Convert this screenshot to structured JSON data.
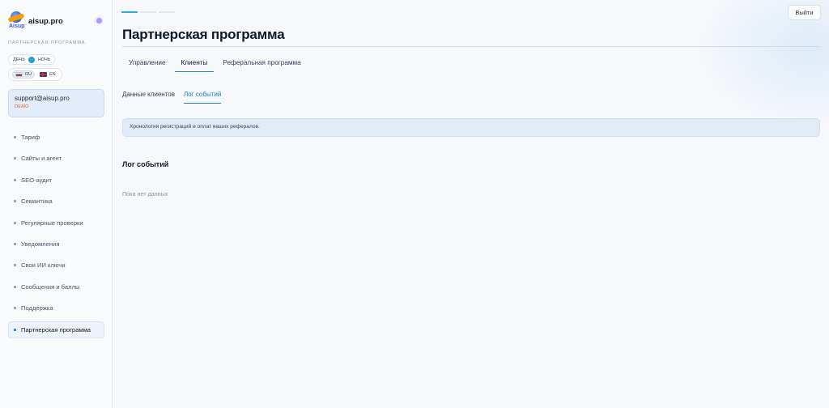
{
  "brand": {
    "name": "aisup.pro",
    "logo_tag": "Aisup"
  },
  "sidebar": {
    "caption": "ПАРТНЕРСКАЯ ПРОГРАММА",
    "theme": {
      "day": "ДЕНЬ",
      "night": "НОЧЬ"
    },
    "lang": {
      "ru": "RU",
      "en": "EN",
      "active": "RU"
    },
    "account": {
      "email": "support@aisup.pro",
      "plan": "DEMO"
    },
    "items": [
      {
        "label": "Тариф"
      },
      {
        "label": "Сайты и агент"
      },
      {
        "label": "SEO-аудит"
      },
      {
        "label": "Семантика"
      },
      {
        "label": "Регулярные проверки"
      },
      {
        "label": "Уведомления"
      },
      {
        "label": "Свои ИИ ключи"
      },
      {
        "label": "Сообщения и баллы"
      },
      {
        "label": "Поддержка"
      },
      {
        "label": "Партнерская программа"
      }
    ],
    "active_item": "Партнерская программа"
  },
  "header": {
    "logout_label": "Выйти"
  },
  "main": {
    "title": "Партнерская программа",
    "tabs": [
      {
        "label": "Управление"
      },
      {
        "label": "Клиенты"
      },
      {
        "label": "Реферальная программа"
      }
    ],
    "active_tab": "Клиенты",
    "subtabs": [
      {
        "label": "Данные клиентов"
      },
      {
        "label": "Лог событий"
      }
    ],
    "active_subtab": "Лог событий",
    "info": "Хронология регистраций и оплат ваших рефералов.",
    "section_title": "Лог событий",
    "empty_text": "Пока нет данных"
  },
  "colors": {
    "accent": "#1e90c8",
    "plan": "#e8590c",
    "banner": "#e2eaf7"
  }
}
